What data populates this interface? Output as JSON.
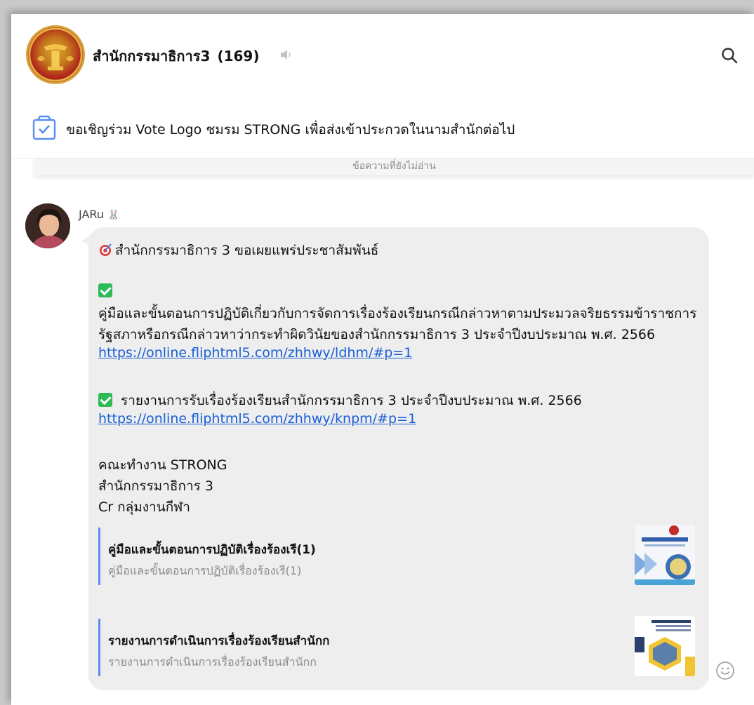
{
  "header": {
    "group_name": "สำนักกรรมาธิการ3",
    "member_count": "(169)"
  },
  "announcement": {
    "text": "ขอเชิญร่วม Vote Logo ชมรม STRONG เพื่อส่งเข้าประกวดในนามสำนักต่อไป"
  },
  "divider": {
    "unread_label": "ข้อความที่ยังไม่อ่าน"
  },
  "message": {
    "sender": "JARu",
    "line_1": "สำนักกรรมาธิการ 3 ขอเผยแพร่ประชาสัมพันธ์",
    "line_2": "คู่มือและขั้นตอนการปฏิบัติเกี่ยวกับการจัดการเรื่องร้องเรียนกรณีกล่าวหาตามประมวลจริยธรรมข้าราชการ",
    "line_3": "รัฐสภาหรือกรณีกล่าวหาว่ากระทำผิดวินัยของสำนักกรรมาธิการ 3 ประจำปีงบประมาณ พ.ศ. 2566",
    "link_1": "https://online.fliphtml5.com/zhhwy/ldhm/#p=1",
    "line_4": "รายงานการรับเรื่องร้องเรียนสำนักกรรมาธิการ 3 ประจำปีงบประมาณ พ.ศ. 2566",
    "link_2": "https://online.fliphtml5.com/zhhwy/knpm/#p=1",
    "line_5": "คณะทำงาน STRONG",
    "line_6": "สำนักกรรมาธิการ 3",
    "line_7": "Cr กลุ่มงานกีฬา"
  },
  "previews": [
    {
      "title": "คู่มือและขั้นตอนการปฏิบัติเรื่องร้องเรี(1)",
      "subtitle": "คู่มือและขั้นตอนการปฏิบัติเรื่องร้องเรี(1)"
    },
    {
      "title": "รายงานการดำเนินการเรื่องร้องเรียนสำนักก",
      "subtitle": "รายงานการดำเนินการเรื่องร้องเรียนสำนักก"
    }
  ],
  "colors": {
    "link": "#1a5fd6",
    "check": "#2dbb57",
    "preview_bar": "#5b8ef0",
    "bubble": "#eeeeee"
  }
}
